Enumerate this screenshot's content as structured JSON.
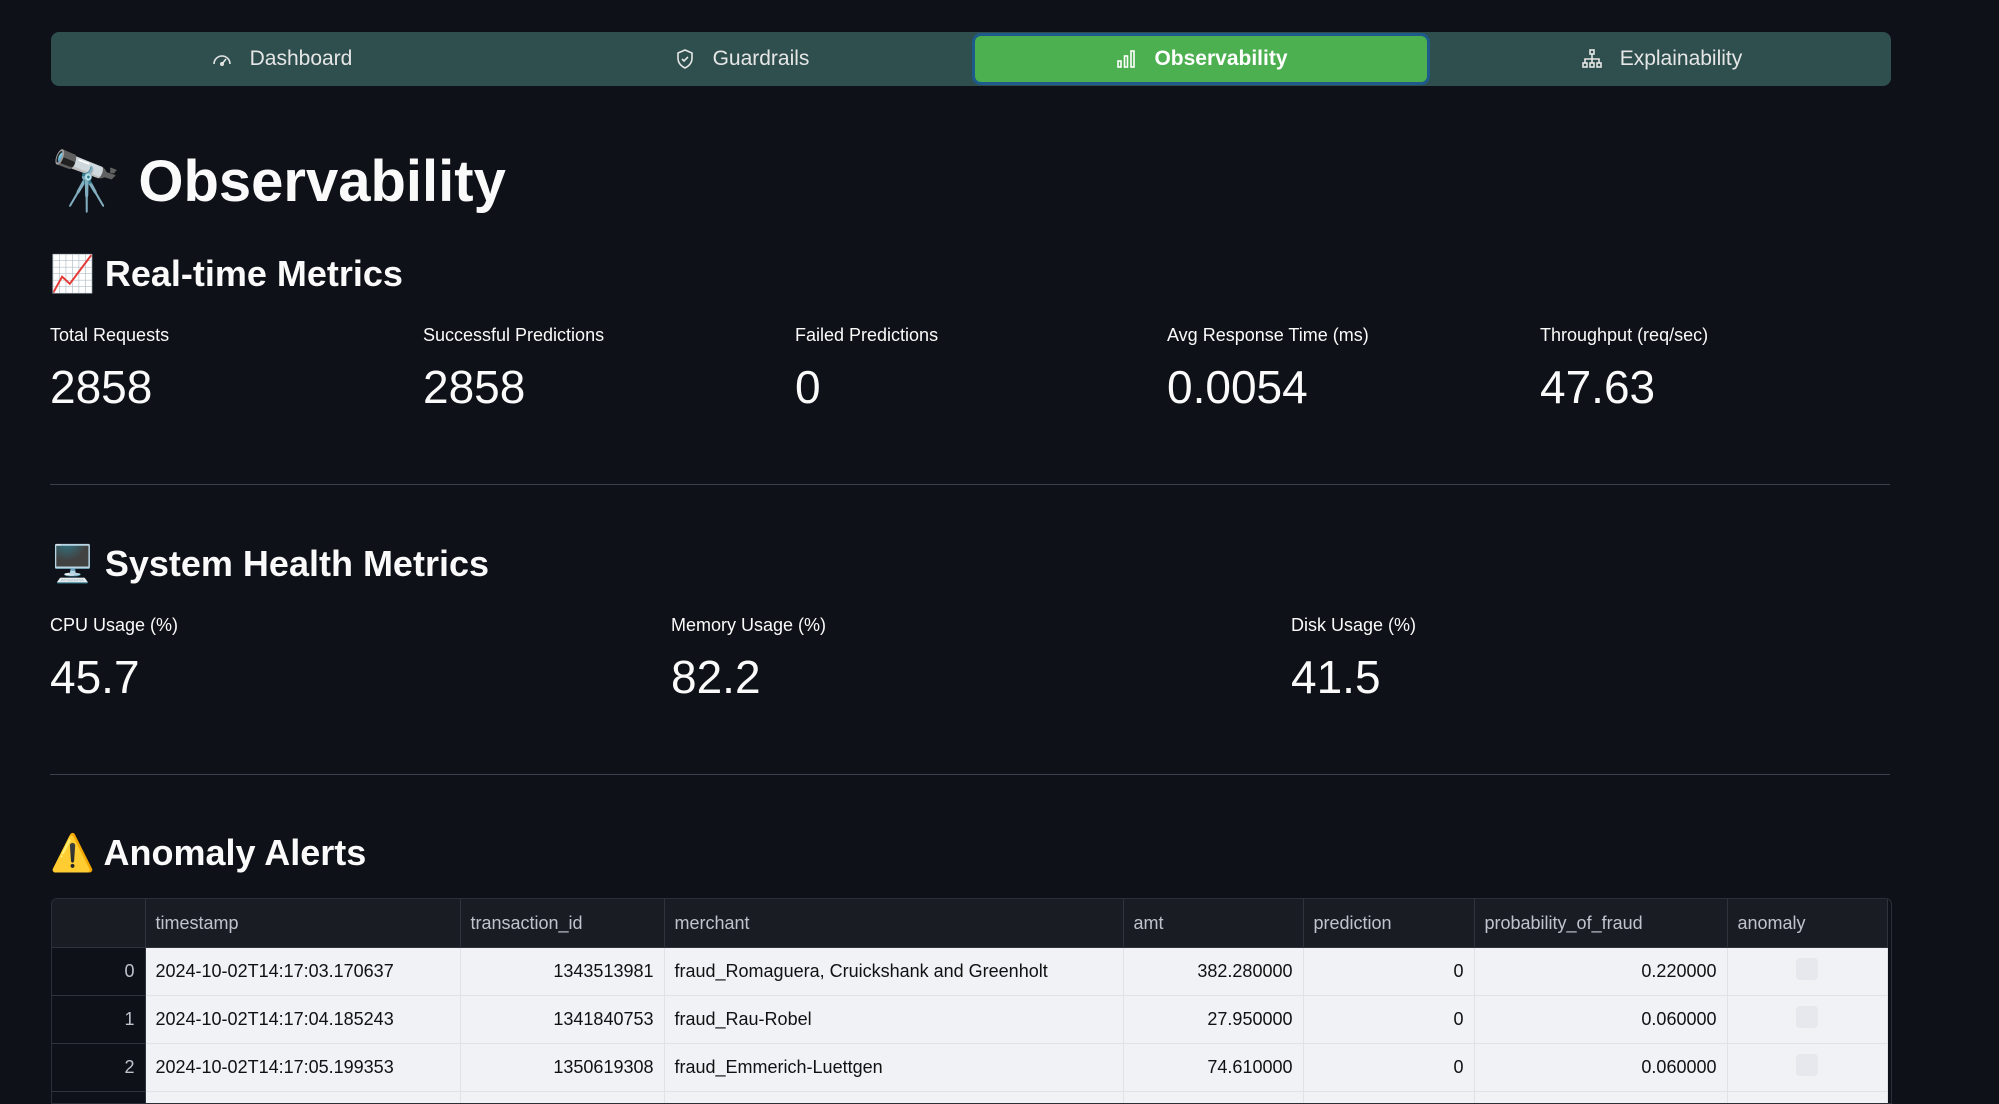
{
  "nav": {
    "items": [
      {
        "label": "Dashboard",
        "icon": "gauge-icon",
        "active": false
      },
      {
        "label": "Guardrails",
        "icon": "shield-icon",
        "active": false
      },
      {
        "label": "Observability",
        "icon": "bar-chart-icon",
        "active": true
      },
      {
        "label": "Explainability",
        "icon": "hierarchy-icon",
        "active": false
      }
    ],
    "active_color": "#4caf50",
    "bar_color": "#2f4f4f"
  },
  "page": {
    "title_emoji": "🔭",
    "title": "Observability"
  },
  "realtime": {
    "emoji": "📈",
    "title": "Real-time Metrics",
    "metrics": [
      {
        "label": "Total Requests",
        "value": "2858"
      },
      {
        "label": "Successful Predictions",
        "value": "2858"
      },
      {
        "label": "Failed Predictions",
        "value": "0"
      },
      {
        "label": "Avg Response Time (ms)",
        "value": "0.0054"
      },
      {
        "label": "Throughput (req/sec)",
        "value": "47.63"
      }
    ]
  },
  "health": {
    "emoji": "🖥️",
    "title": "System Health Metrics",
    "metrics": [
      {
        "label": "CPU Usage (%)",
        "value": "45.7"
      },
      {
        "label": "Memory Usage (%)",
        "value": "82.2"
      },
      {
        "label": "Disk Usage (%)",
        "value": "41.5"
      }
    ]
  },
  "anomaly": {
    "emoji": "⚠️",
    "title": "Anomaly Alerts",
    "columns": [
      "timestamp",
      "transaction_id",
      "merchant",
      "amt",
      "prediction",
      "probability_of_fraud",
      "anomaly"
    ],
    "rows": [
      {
        "index": "0",
        "timestamp": "2024-10-02T14:17:03.170637",
        "transaction_id": "1343513981",
        "merchant": "fraud_Romaguera, Cruickshank and Greenholt",
        "amt": "382.280000",
        "prediction": "0",
        "probability_of_fraud": "0.220000",
        "anomaly": false
      },
      {
        "index": "1",
        "timestamp": "2024-10-02T14:17:04.185243",
        "transaction_id": "1341840753",
        "merchant": "fraud_Rau-Robel",
        "amt": "27.950000",
        "prediction": "0",
        "probability_of_fraud": "0.060000",
        "anomaly": false
      },
      {
        "index": "2",
        "timestamp": "2024-10-02T14:17:05.199353",
        "transaction_id": "1350619308",
        "merchant": "fraud_Emmerich-Luettgen",
        "amt": "74.610000",
        "prediction": "0",
        "probability_of_fraud": "0.060000",
        "anomaly": false
      }
    ]
  }
}
